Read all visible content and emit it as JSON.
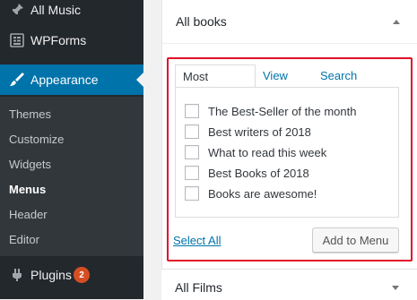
{
  "sidebar": {
    "items": [
      {
        "label": "All Music",
        "icon": "pin-icon"
      },
      {
        "label": "WPForms",
        "icon": "forms-icon"
      },
      {
        "label": "Appearance",
        "icon": "brush-icon",
        "active": true
      },
      {
        "label": "Plugins",
        "icon": "plug-icon",
        "badge": "2"
      }
    ],
    "submenu": [
      "Themes",
      "Customize",
      "Widgets",
      "Menus",
      "Header",
      "Editor"
    ],
    "current_submenu": "Menus",
    "accent_color": "#0073aa",
    "badge_color": "#d54e21"
  },
  "books_panel": {
    "title": "All books",
    "tabs": [
      "Most Recent",
      "View All",
      "Search"
    ],
    "items": [
      "The Best-Seller of the month",
      "Best writers of 2018",
      "What to read this week",
      "Best Books of 2018",
      "Books are awesome!"
    ],
    "select_all": "Select All",
    "add_button": "Add to Menu",
    "highlight_color": "#e0102a"
  },
  "films_panel": {
    "title": "All Films"
  }
}
